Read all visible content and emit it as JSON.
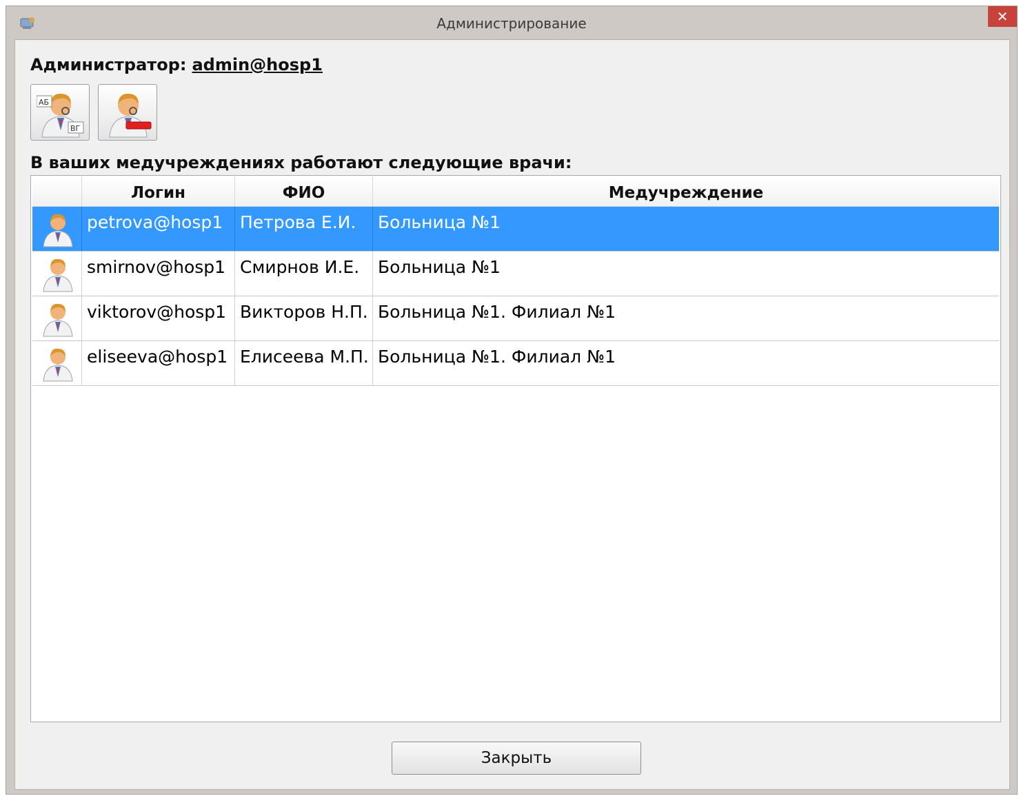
{
  "window": {
    "title": "Администрирование",
    "close_glyph": "✕"
  },
  "admin": {
    "label": "Администратор:",
    "login": "admin@hosp1"
  },
  "toolbar": {
    "buttons": [
      {
        "icon": "doctor-abc-icon",
        "badge_top": "АБ",
        "badge_bottom": "ВГ"
      },
      {
        "icon": "doctor-remove-icon"
      }
    ]
  },
  "doctors_label": "В ваших медучреждениях работают следующие врачи:",
  "table": {
    "columns": [
      "Логин",
      "ФИО",
      "Медучреждение"
    ],
    "rows": [
      {
        "login": "petrova@hosp1",
        "fio": "Петрова Е.И.",
        "org": "Больница №1",
        "selected": true
      },
      {
        "login": "smirnov@hosp1",
        "fio": "Смирнов И.Е.",
        "org": "Больница №1",
        "selected": false
      },
      {
        "login": "viktorov@hosp1",
        "fio": "Викторов Н.П.",
        "org": "Больница №1. Филиал №1",
        "selected": false
      },
      {
        "login": "eliseeva@hosp1",
        "fio": "Елисеева М.П.",
        "org": "Больница №1. Филиал №1",
        "selected": false
      }
    ]
  },
  "close_button_label": "Закрыть",
  "colors": {
    "selection": "#3399ff",
    "title_close": "#c7423a"
  }
}
